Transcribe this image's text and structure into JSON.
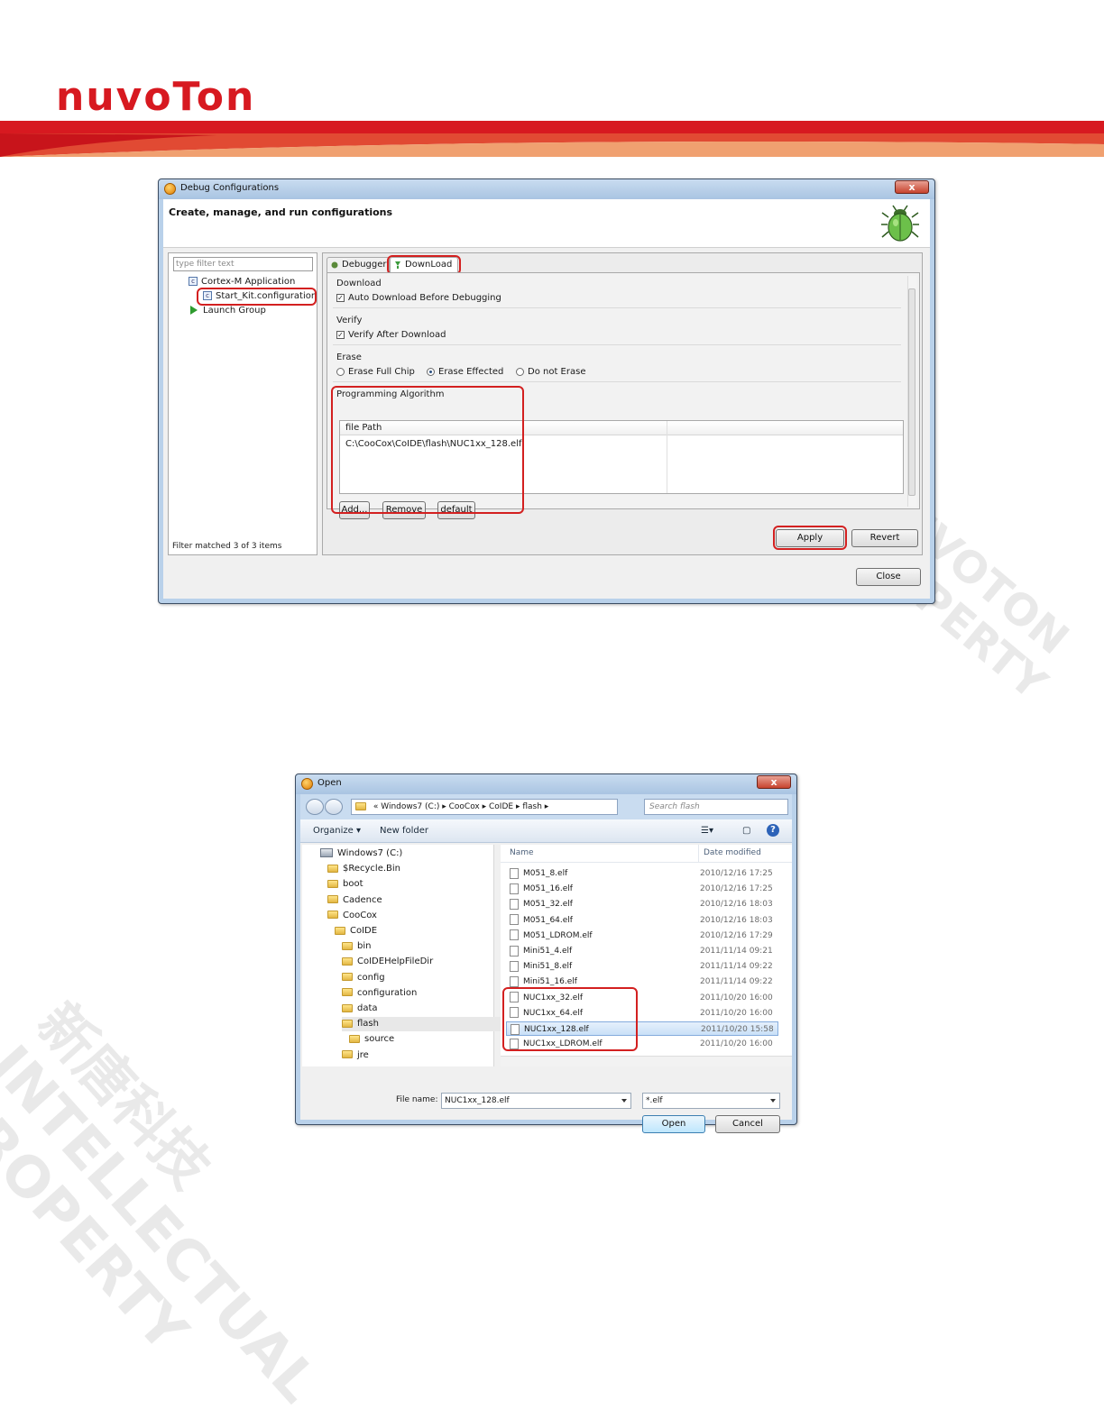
{
  "brand": {
    "logo_text": "nuvoTon",
    "red": "#d71920",
    "watermark_cn": "新唐科技",
    "watermark_en1": "INTELLECTUAL",
    "watermark_en2": "PROPERTY",
    "watermark_en3": "NUVOTON"
  },
  "debug_dialog": {
    "title": "Debug Configurations",
    "close_glyph": "x",
    "header": "Create, manage, and run configurations",
    "filter_placeholder": "type filter text",
    "tree": [
      {
        "label": "Cortex-M Application"
      },
      {
        "label": "Start_Kit.configuration"
      },
      {
        "label": "Launch Group"
      }
    ],
    "filter_status": "Filter matched 3 of 3 items",
    "tabs": [
      {
        "label": "Debugger"
      },
      {
        "label": "DownLoad"
      }
    ],
    "download": {
      "title": "Download",
      "auto_download": "Auto Download Before Debugging",
      "auto_download_checked": true
    },
    "verify": {
      "title": "Verify",
      "verify_after": "Verify After Download",
      "verify_checked": true
    },
    "erase": {
      "title": "Erase",
      "full_chip": "Erase Full Chip",
      "effected": "Erase Effected",
      "no_erase": "Do not Erase",
      "selected": "Erase Effected"
    },
    "algorithm": {
      "title": "Programming Algorithm",
      "column": "file Path",
      "rows": [
        "C:\\CooCox\\CoIDE\\flash\\NUC1xx_128.elf"
      ]
    },
    "buttons": {
      "add": "Add...",
      "remove": "Remove",
      "default": "default",
      "apply": "Apply",
      "revert": "Revert",
      "close": "Close"
    }
  },
  "open_dialog": {
    "title": "Open",
    "close_glyph": "x",
    "path": [
      "Windows7 (C:)",
      "CooCox",
      "CoIDE",
      "flash"
    ],
    "path_prefix": "«",
    "search_placeholder": "Search flash",
    "toolbar": {
      "organize": "Organize ▾",
      "new_folder": "New folder"
    },
    "nav": [
      {
        "label": "Windows7 (C:)",
        "type": "drive",
        "indent": 0
      },
      {
        "label": "$Recycle.Bin",
        "type": "folder",
        "indent": 1
      },
      {
        "label": "boot",
        "type": "folder",
        "indent": 1
      },
      {
        "label": "Cadence",
        "type": "folder",
        "indent": 1
      },
      {
        "label": "CooCox",
        "type": "folder",
        "indent": 1
      },
      {
        "label": "CoIDE",
        "type": "folder",
        "indent": 2
      },
      {
        "label": "bin",
        "type": "folder",
        "indent": 3
      },
      {
        "label": "CoIDEHelpFileDir",
        "type": "folder",
        "indent": 3
      },
      {
        "label": "config",
        "type": "folder",
        "indent": 3
      },
      {
        "label": "configuration",
        "type": "folder",
        "indent": 3
      },
      {
        "label": "data",
        "type": "folder",
        "indent": 3
      },
      {
        "label": "flash",
        "type": "folder",
        "indent": 3,
        "selected": true
      },
      {
        "label": "source",
        "type": "folder",
        "indent": 4
      },
      {
        "label": "jre",
        "type": "folder",
        "indent": 3
      }
    ],
    "columns": {
      "name": "Name",
      "date": "Date modified"
    },
    "files": [
      {
        "name": "M051_8.elf",
        "date": "2010/12/16 17:25"
      },
      {
        "name": "M051_16.elf",
        "date": "2010/12/16 17:25"
      },
      {
        "name": "M051_32.elf",
        "date": "2010/12/16 18:03"
      },
      {
        "name": "M051_64.elf",
        "date": "2010/12/16 18:03"
      },
      {
        "name": "M051_LDROM.elf",
        "date": "2010/12/16 17:29"
      },
      {
        "name": "Mini51_4.elf",
        "date": "2011/11/14 09:21"
      },
      {
        "name": "Mini51_8.elf",
        "date": "2011/11/14 09:22"
      },
      {
        "name": "Mini51_16.elf",
        "date": "2011/11/14 09:22"
      },
      {
        "name": "NUC1xx_32.elf",
        "date": "2011/10/20 16:00"
      },
      {
        "name": "NUC1xx_64.elf",
        "date": "2011/10/20 16:00"
      },
      {
        "name": "NUC1xx_128.elf",
        "date": "2011/10/20 15:58",
        "selected": true
      },
      {
        "name": "NUC1xx_LDROM.elf",
        "date": "2011/10/20 16:00"
      }
    ],
    "filename_label": "File name:",
    "filename_value": "NUC1xx_128.elf",
    "filetype_value": "*.elf",
    "buttons": {
      "open": "Open",
      "cancel": "Cancel"
    }
  }
}
